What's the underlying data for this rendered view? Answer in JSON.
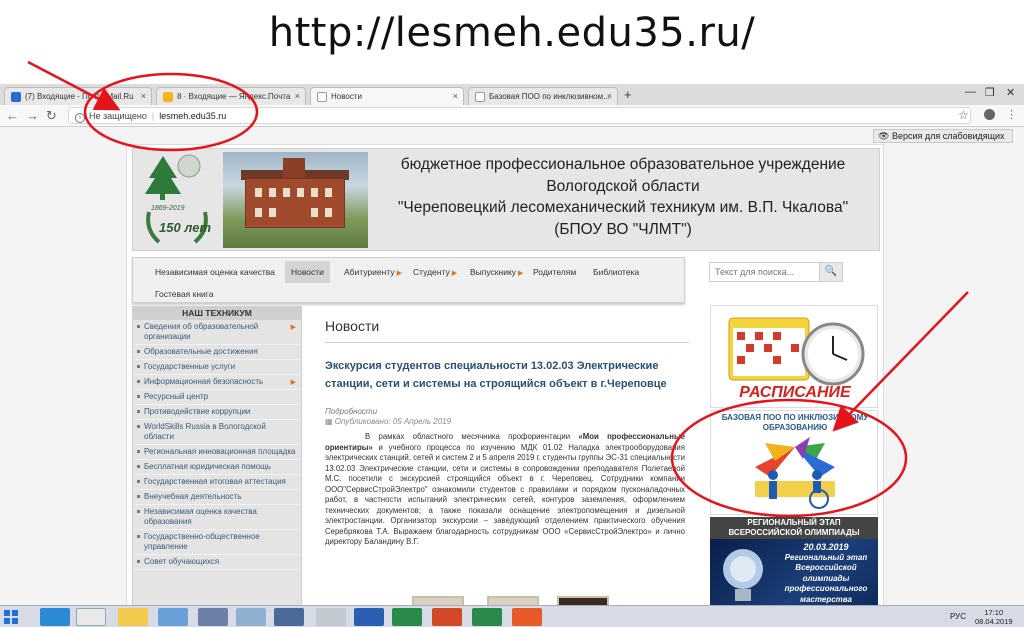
{
  "slide": {
    "title": "http://lesmeh.edu35.ru/"
  },
  "browser": {
    "tabs": [
      {
        "label": "(7) Входящие - Почта Mail.Ru",
        "active": false
      },
      {
        "label": "8 · Входящие — Яндекс.Почта",
        "active": false
      },
      {
        "label": "Новости",
        "active": true
      },
      {
        "label": "Базовая ПОО по инклюзивном...",
        "active": false
      }
    ],
    "new_tab": "+",
    "address": {
      "security": "Не защищено",
      "url": "lesmeh.edu35.ru"
    }
  },
  "page": {
    "vision_button": "Версия для слабовидящих",
    "header": {
      "logo_years": "1869-2019",
      "logo_anniv": "150 лет",
      "lines": [
        "бюджетное профессиональное образовательное учреждение",
        "Вологодской области",
        "\"Череповецкий лесомеханический техникум им. В.П. Чкалова\"",
        "(БПОУ ВО \"ЧЛМТ\")"
      ]
    },
    "nav": [
      {
        "label": "Независимая оценка качества",
        "arrow": false
      },
      {
        "label": "Новости",
        "arrow": false,
        "active": true
      },
      {
        "label": "Абитуриенту",
        "arrow": true
      },
      {
        "label": "Студенту",
        "arrow": true
      },
      {
        "label": "Выпускнику",
        "arrow": true
      },
      {
        "label": "Родителям",
        "arrow": false
      },
      {
        "label": "Библиотека",
        "arrow": false
      },
      {
        "label": "Гостевая книга",
        "arrow": false
      }
    ],
    "search": {
      "placeholder": "Текст для поиска...",
      "button": "🔍"
    },
    "sidebar": {
      "title": "НАШ ТЕХНИКУМ",
      "items": [
        {
          "label": "Сведения об образовательной организации",
          "arrow": true
        },
        {
          "label": "Образовательные достижения",
          "arrow": false
        },
        {
          "label": "Государственные услуги",
          "arrow": false
        },
        {
          "label": "Информационная безопасность",
          "arrow": true
        },
        {
          "label": "Ресурсный центр",
          "arrow": false
        },
        {
          "label": "Противодействие коррупции",
          "arrow": false
        },
        {
          "label": "WorldSkills Russia в Вологодской области",
          "arrow": false
        },
        {
          "label": "Региональная инновационная площадка",
          "arrow": false
        },
        {
          "label": "Бесплатная юридическая помощь",
          "arrow": false
        },
        {
          "label": "Государственная итоговая аттестация",
          "arrow": false
        },
        {
          "label": "Внеучебная деятельность",
          "arrow": false
        },
        {
          "label": "Независимая оценка качества образования",
          "arrow": false
        },
        {
          "label": "Государственно-общественное управление",
          "arrow": false
        },
        {
          "label": "Совет обучающихся",
          "arrow": false
        }
      ]
    },
    "content": {
      "heading": "Новости",
      "article_title": "Экскурсия студентов специальности 13.02.03 Электрические станции, сети и системы на строящийся объект в г.Череповце",
      "more": "Подробности",
      "published": "Опубликовано: 05 Апрель 2019",
      "body_pre": "В рамках областного месячника профориентации ",
      "body_bold": "«Мои профессиональные ориентиры»",
      "body_post": " и учебного процесса по изучению МДК 01.02 Наладка электрооборудования электрических станций, сетей и систем 2 и 5 апреля 2019 г. студенты группы ЭС-31 специальности 13.02.03 Электрические станции, сети и системы в сопровождении преподавателя Полетаевой М.С. посетили с экскурсией строящийся объект в г. Череповец. Сотрудники компании ООО\"СервисСтройЭлектро\" ознакомили студентов с правилами и порядком пусконаладочных работ, в частности испытаний электрических сетей, контуров заземления, оформлением технических документов; а также показали оснащение электропомещения и дизельной электростанции. Организатор экскурсии – заведующий отделением практического обучения Серебрякова Т.А. Выражаем благодарность сотрудникам ООО «СервисСтройЭлектро» и лично директору Баландину В.Г."
    },
    "banners": {
      "schedule": "РАСПИСАНИЕ",
      "inclusive_title": "БАЗОВАЯ ПОО ПО ИНКЛЮЗИВНОМУ ОБРАЗОВАНИЮ",
      "olymp_title": "РЕГИОНАЛЬНЫЙ ЭТАП ВСЕРОССИЙСКОЙ ОЛИМПИАДЫ",
      "olymp_date": "20.03.2019",
      "olymp_text": "Региональный этап Всероссийской олимпиады профессионального мастерства"
    }
  },
  "taskbar": {
    "lang": "РУС",
    "time": "17:10",
    "date": "08.04.2019"
  },
  "colors": {
    "annotation": "#e5131b",
    "link": "#2a5078",
    "accent_arrow": "#d9771a"
  }
}
